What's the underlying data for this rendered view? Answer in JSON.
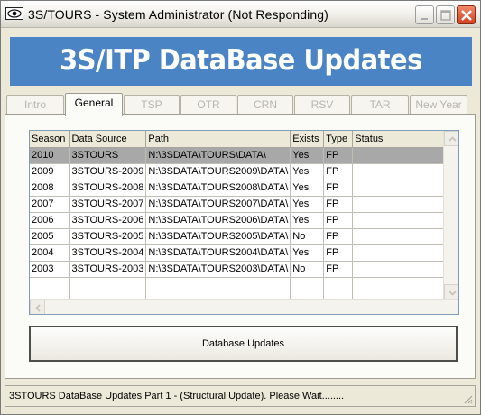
{
  "window": {
    "title": "3S/TOURS - System Administrator (Not Responding)",
    "icons": [
      "app-eye-icon",
      "minimize-icon",
      "maximize-icon",
      "close-icon"
    ]
  },
  "banner": {
    "title": "3S/ITP DataBase Updates",
    "color": "#4a84c4"
  },
  "tabs": [
    {
      "label": "Intro",
      "active": false
    },
    {
      "label": "General",
      "active": true
    },
    {
      "label": "TSP",
      "active": false
    },
    {
      "label": "OTR",
      "active": false
    },
    {
      "label": "CRN",
      "active": false
    },
    {
      "label": "RSV",
      "active": false
    },
    {
      "label": "TAR",
      "active": false
    },
    {
      "label": "New Year",
      "active": false
    }
  ],
  "grid": {
    "columns": [
      "Season",
      "Data Source",
      "Path",
      "Exists",
      "Type",
      "Status"
    ],
    "rows": [
      {
        "season": "2010",
        "source": "3STOURS",
        "path": "N:\\3SDATA\\TOURS\\DATA\\",
        "exists": "Yes",
        "type": "FP",
        "status": "",
        "selected": true
      },
      {
        "season": "2009",
        "source": "3STOURS-2009",
        "path": "N:\\3SDATA\\TOURS2009\\DATA\\",
        "exists": "Yes",
        "type": "FP",
        "status": ""
      },
      {
        "season": "2008",
        "source": "3STOURS-2008",
        "path": "N:\\3SDATA\\TOURS2008\\DATA\\",
        "exists": "Yes",
        "type": "FP",
        "status": ""
      },
      {
        "season": "2007",
        "source": "3STOURS-2007",
        "path": "N:\\3SDATA\\TOURS2007\\DATA\\",
        "exists": "Yes",
        "type": "FP",
        "status": ""
      },
      {
        "season": "2006",
        "source": "3STOURS-2006",
        "path": "N:\\3SDATA\\TOURS2006\\DATA\\",
        "exists": "Yes",
        "type": "FP",
        "status": ""
      },
      {
        "season": "2005",
        "source": "3STOURS-2005",
        "path": "N:\\3SDATA\\TOURS2005\\DATA\\",
        "exists": "No",
        "type": "FP",
        "status": ""
      },
      {
        "season": "2004",
        "source": "3STOURS-2004",
        "path": "N:\\3SDATA\\TOURS2004\\DATA\\",
        "exists": "Yes",
        "type": "FP",
        "status": ""
      },
      {
        "season": "2003",
        "source": "3STOURS-2003",
        "path": "N:\\3SDATA\\TOURS2003\\DATA\\",
        "exists": "No",
        "type": "FP",
        "status": ""
      }
    ]
  },
  "button": {
    "label": "Database Updates"
  },
  "status": {
    "text": "3STOURS DataBase Updates Part 1 - (Structural Update).  Please Wait........"
  }
}
